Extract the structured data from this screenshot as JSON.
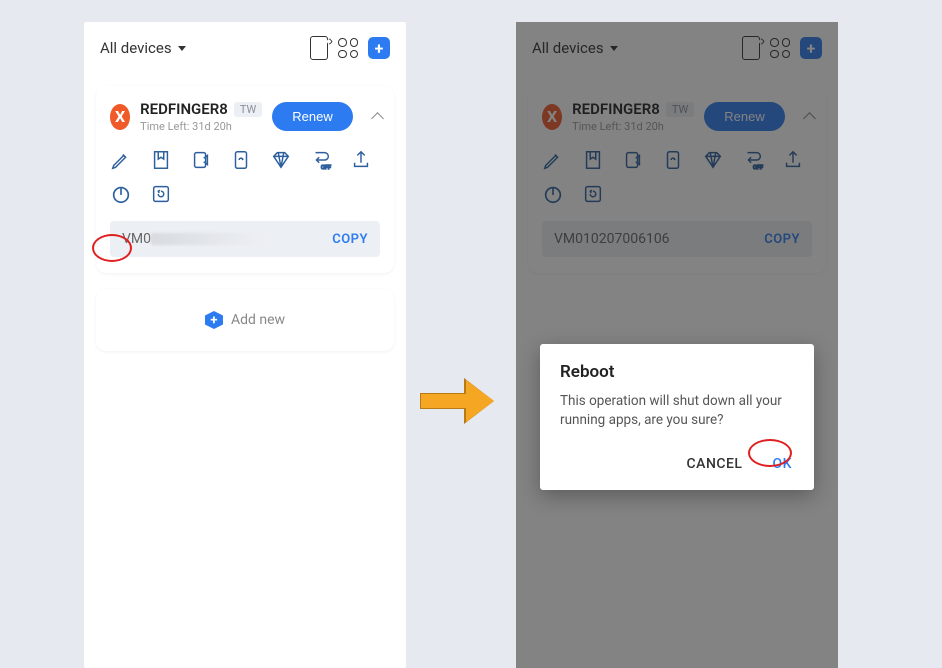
{
  "header": {
    "dropdown_label": "All devices"
  },
  "device": {
    "avatar_letter": "X",
    "name": "REDFINGER8",
    "badge": "TW",
    "subtitle": "Time Left: 31d 20h",
    "renew_label": "Renew"
  },
  "vm": {
    "id_masked_prefix": "VM0",
    "id_full": "VM010207006106",
    "copy_label": "COPY"
  },
  "addnew": {
    "label": "Add new"
  },
  "dialog": {
    "title": "Reboot",
    "message": "This operation will shut down all your running apps, are you sure?",
    "cancel": "CANCEL",
    "ok": "OK"
  },
  "colors": {
    "accent": "#2d7bf0",
    "highlight": "#e02020",
    "arrow": "#f5a623"
  }
}
